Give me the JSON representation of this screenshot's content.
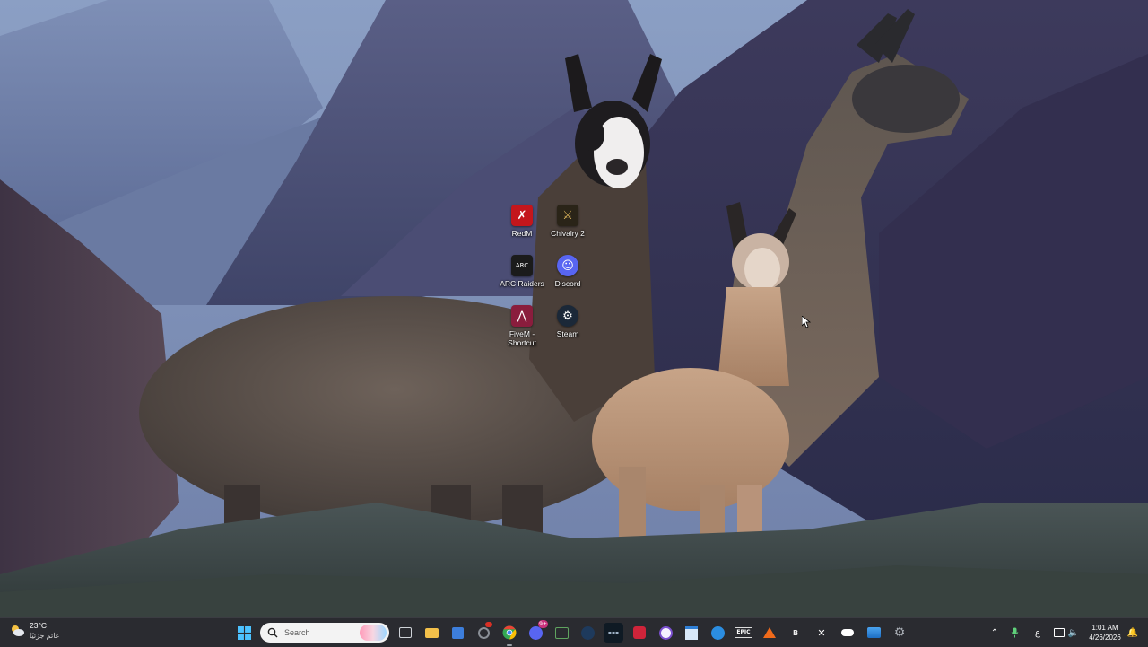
{
  "desktop": {
    "icons": [
      {
        "label": "RedM",
        "icon": "redm-icon",
        "color": "#c4161c"
      },
      {
        "label": "Chivalry 2",
        "icon": "chivalry-2-icon",
        "color": "#b08a3a"
      },
      {
        "label": "ARC Raiders",
        "icon": "arc-raiders-icon",
        "color": "#1b1b1b"
      },
      {
        "label": "Discord",
        "icon": "discord-icon",
        "color": "#5865f2"
      },
      {
        "label": "FiveM -\nShortcut",
        "icon": "fivem-icon",
        "color": "#f0a0c0"
      },
      {
        "label": "Steam",
        "icon": "steam-icon",
        "color": "#1b2838"
      }
    ]
  },
  "taskbar": {
    "weather": {
      "temp": "23°C",
      "condition": "غائم جزئيًا",
      "icon": "partly-cloudy-icon"
    },
    "search": {
      "placeholder": "Search"
    },
    "apps": [
      {
        "name": "start-button",
        "icon": "windows-logo-icon"
      },
      {
        "name": "task-view-button",
        "icon": "task-view-icon"
      },
      {
        "name": "file-explorer-button",
        "icon": "folder-icon"
      },
      {
        "name": "microsoft-store-button",
        "icon": "store-icon"
      },
      {
        "name": "app-button-1",
        "icon": "settings-app-icon"
      },
      {
        "name": "chrome-button",
        "icon": "chrome-icon"
      },
      {
        "name": "discord-button",
        "icon": "discord-icon",
        "badge": "9+"
      },
      {
        "name": "app-button-2",
        "icon": "xbox-icon"
      },
      {
        "name": "steam-button",
        "icon": "steam-icon"
      },
      {
        "name": "app-button-3",
        "icon": "terminal-icon"
      },
      {
        "name": "app-button-4",
        "icon": "game-icon"
      },
      {
        "name": "app-button-5",
        "icon": "media-icon"
      },
      {
        "name": "app-button-6",
        "icon": "notepad-icon"
      },
      {
        "name": "app-button-7",
        "icon": "edge-icon"
      },
      {
        "name": "epic-games-button",
        "icon": "epic-games-icon",
        "label": "EPIC"
      },
      {
        "name": "app-button-8",
        "icon": "launcher-icon"
      },
      {
        "name": "app-button-9",
        "icon": "game-launcher-icon"
      },
      {
        "name": "app-button-10",
        "icon": "x-app-icon"
      },
      {
        "name": "app-button-11",
        "icon": "controller-icon"
      },
      {
        "name": "app-button-12",
        "icon": "photos-icon"
      },
      {
        "name": "settings-button",
        "icon": "gear-icon"
      }
    ],
    "tray": {
      "language": "ع",
      "date_time": {
        "time": "1:01 AM",
        "date": "4/26/2026"
      }
    }
  }
}
